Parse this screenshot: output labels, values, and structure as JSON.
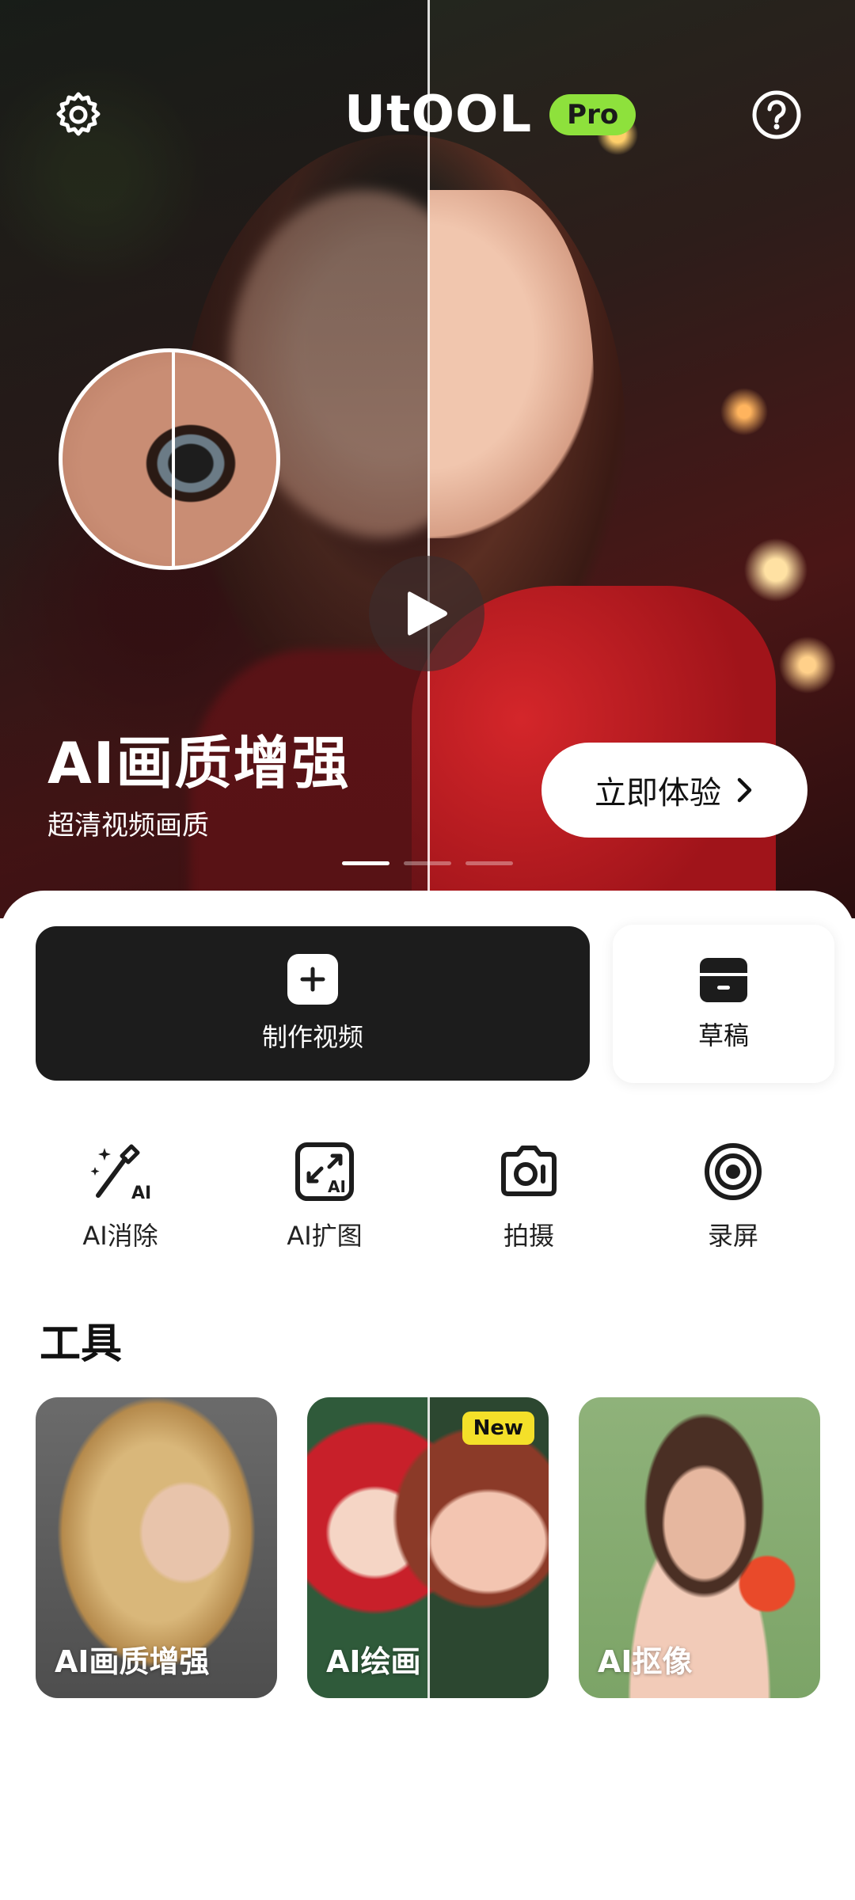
{
  "header": {
    "logo_text": "UtOOL",
    "pro_badge": "Pro",
    "settings_icon": "gear-icon",
    "help_icon": "question-circle-icon"
  },
  "banner": {
    "title": "AI画质增强",
    "subtitle": "超清视频画质",
    "cta_label": "立即体验",
    "slides_total": 3,
    "active_slide": 1
  },
  "actions": {
    "make_video_label": "制作视频",
    "drafts_label": "草稿"
  },
  "quick_tools": [
    {
      "label": "AI消除",
      "icon": "magic-wand-ai-icon"
    },
    {
      "label": "AI扩图",
      "icon": "expand-image-ai-icon"
    },
    {
      "label": "拍摄",
      "icon": "camera-icon"
    },
    {
      "label": "录屏",
      "icon": "screen-record-icon"
    }
  ],
  "tools": {
    "heading": "工具",
    "cards": [
      {
        "label": "AI画质增强"
      },
      {
        "label": "AI绘画",
        "badge": "New"
      },
      {
        "label": "AI抠像"
      }
    ]
  },
  "colors": {
    "accent_green": "#8ee13c",
    "new_badge": "#f4e029",
    "dark_button": "#1c1c1c"
  }
}
